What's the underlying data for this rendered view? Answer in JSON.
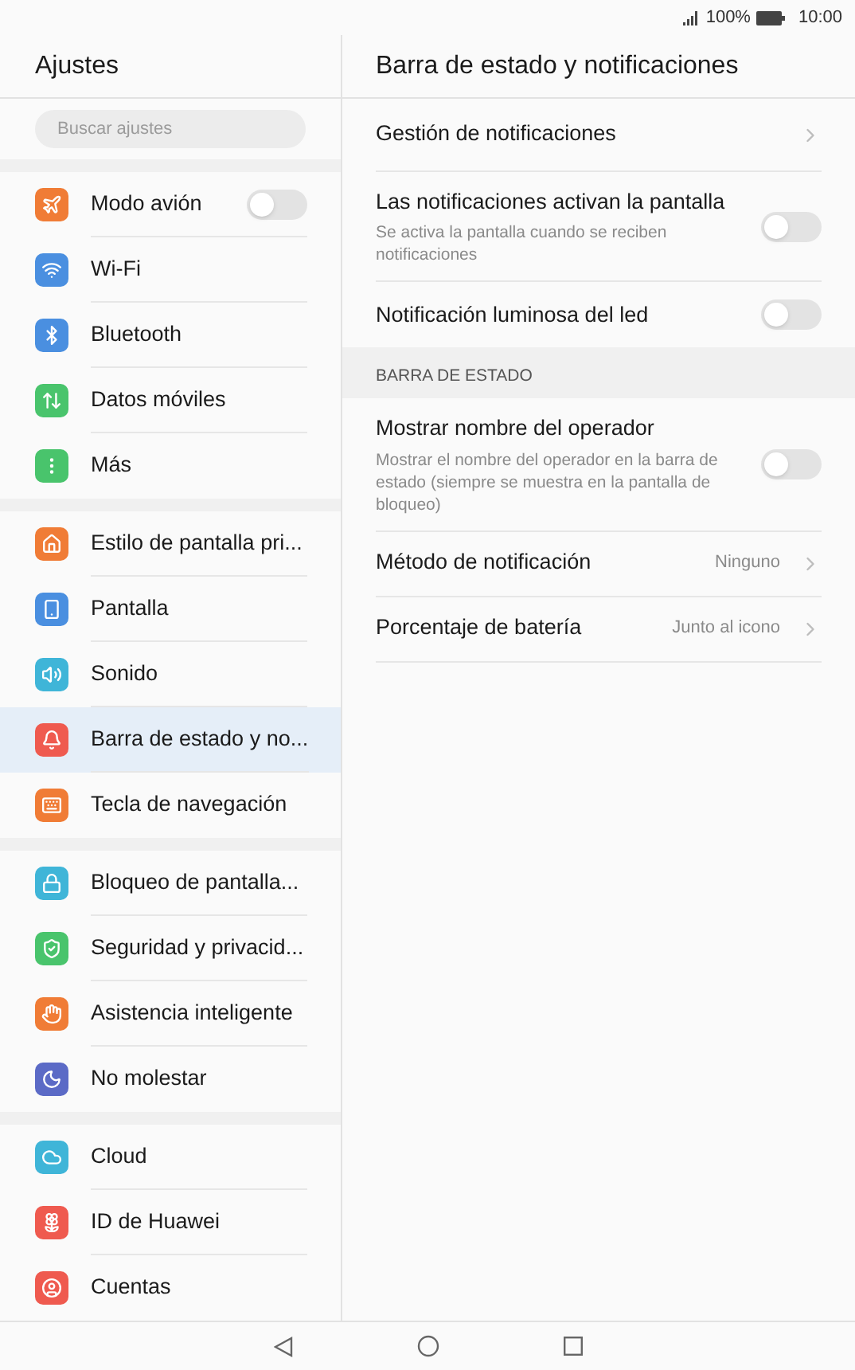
{
  "status_bar": {
    "battery": "100%",
    "time": "10:00"
  },
  "sidebar": {
    "title": "Ajustes",
    "search": {
      "placeholder": "Buscar ajustes"
    },
    "groups": [
      {
        "items": [
          {
            "label": "Modo avión",
            "color": "#f07c36",
            "kind": "toggle",
            "on": false,
            "selected": false
          },
          {
            "label": "Wi-Fi",
            "color": "#4a8fe0",
            "kind": "link",
            "selected": false
          },
          {
            "label": "Bluetooth",
            "color": "#4a8fe0",
            "kind": "link",
            "selected": false
          },
          {
            "label": "Datos móviles",
            "color": "#49c46c",
            "kind": "link",
            "selected": false
          },
          {
            "label": "Más",
            "color": "#49c46c",
            "kind": "link",
            "selected": false
          }
        ]
      },
      {
        "items": [
          {
            "label": "Estilo de pantalla pri...",
            "color": "#f07c36",
            "kind": "link",
            "selected": false
          },
          {
            "label": "Pantalla",
            "color": "#4a8fe0",
            "kind": "link",
            "selected": false
          },
          {
            "label": "Sonido",
            "color": "#3fb5d8",
            "kind": "link",
            "selected": false
          },
          {
            "label": "Barra de estado y no...",
            "color": "#ef5a4f",
            "kind": "link",
            "selected": true
          },
          {
            "label": "Tecla de navegación",
            "color": "#f07c36",
            "kind": "link",
            "selected": false
          }
        ]
      },
      {
        "items": [
          {
            "label": "Bloqueo de pantalla...",
            "color": "#3fb5d8",
            "kind": "link",
            "selected": false
          },
          {
            "label": "Seguridad y privacid...",
            "color": "#49c46c",
            "kind": "link",
            "selected": false
          },
          {
            "label": "Asistencia inteligente",
            "color": "#f07c36",
            "kind": "link",
            "selected": false
          },
          {
            "label": "No molestar",
            "color": "#5b6ac6",
            "kind": "link",
            "selected": false
          }
        ]
      },
      {
        "items": [
          {
            "label": "Cloud",
            "color": "#3fb5d8",
            "kind": "link",
            "selected": false
          },
          {
            "label": "ID de Huawei",
            "color": "#ef5a4f",
            "kind": "link",
            "selected": false
          },
          {
            "label": "Cuentas",
            "color": "#ef5a4f",
            "kind": "link",
            "selected": false
          }
        ]
      }
    ]
  },
  "detail": {
    "title": "Barra de estado y notificaciones",
    "rows": [
      {
        "kind": "link",
        "label": "Gestión de notificaciones"
      },
      {
        "kind": "toggle",
        "label": "Las notificaciones activan la pantalla",
        "description": "Se activa la pantalla cuando se reciben notificaciones",
        "on": false
      },
      {
        "kind": "toggle",
        "label": "Notificación luminosa del led",
        "on": false
      },
      {
        "kind": "section",
        "label": "BARRA DE ESTADO"
      },
      {
        "kind": "toggle",
        "label": "Mostrar nombre del operador",
        "description": "Mostrar el nombre del operador en la barra de estado (siempre se muestra en la pantalla de bloqueo)",
        "on": false
      },
      {
        "kind": "link",
        "label": "Método de notificación",
        "value": "Ninguno"
      },
      {
        "kind": "link",
        "label": "Porcentaje de batería",
        "value": "Junto al icono"
      }
    ]
  }
}
